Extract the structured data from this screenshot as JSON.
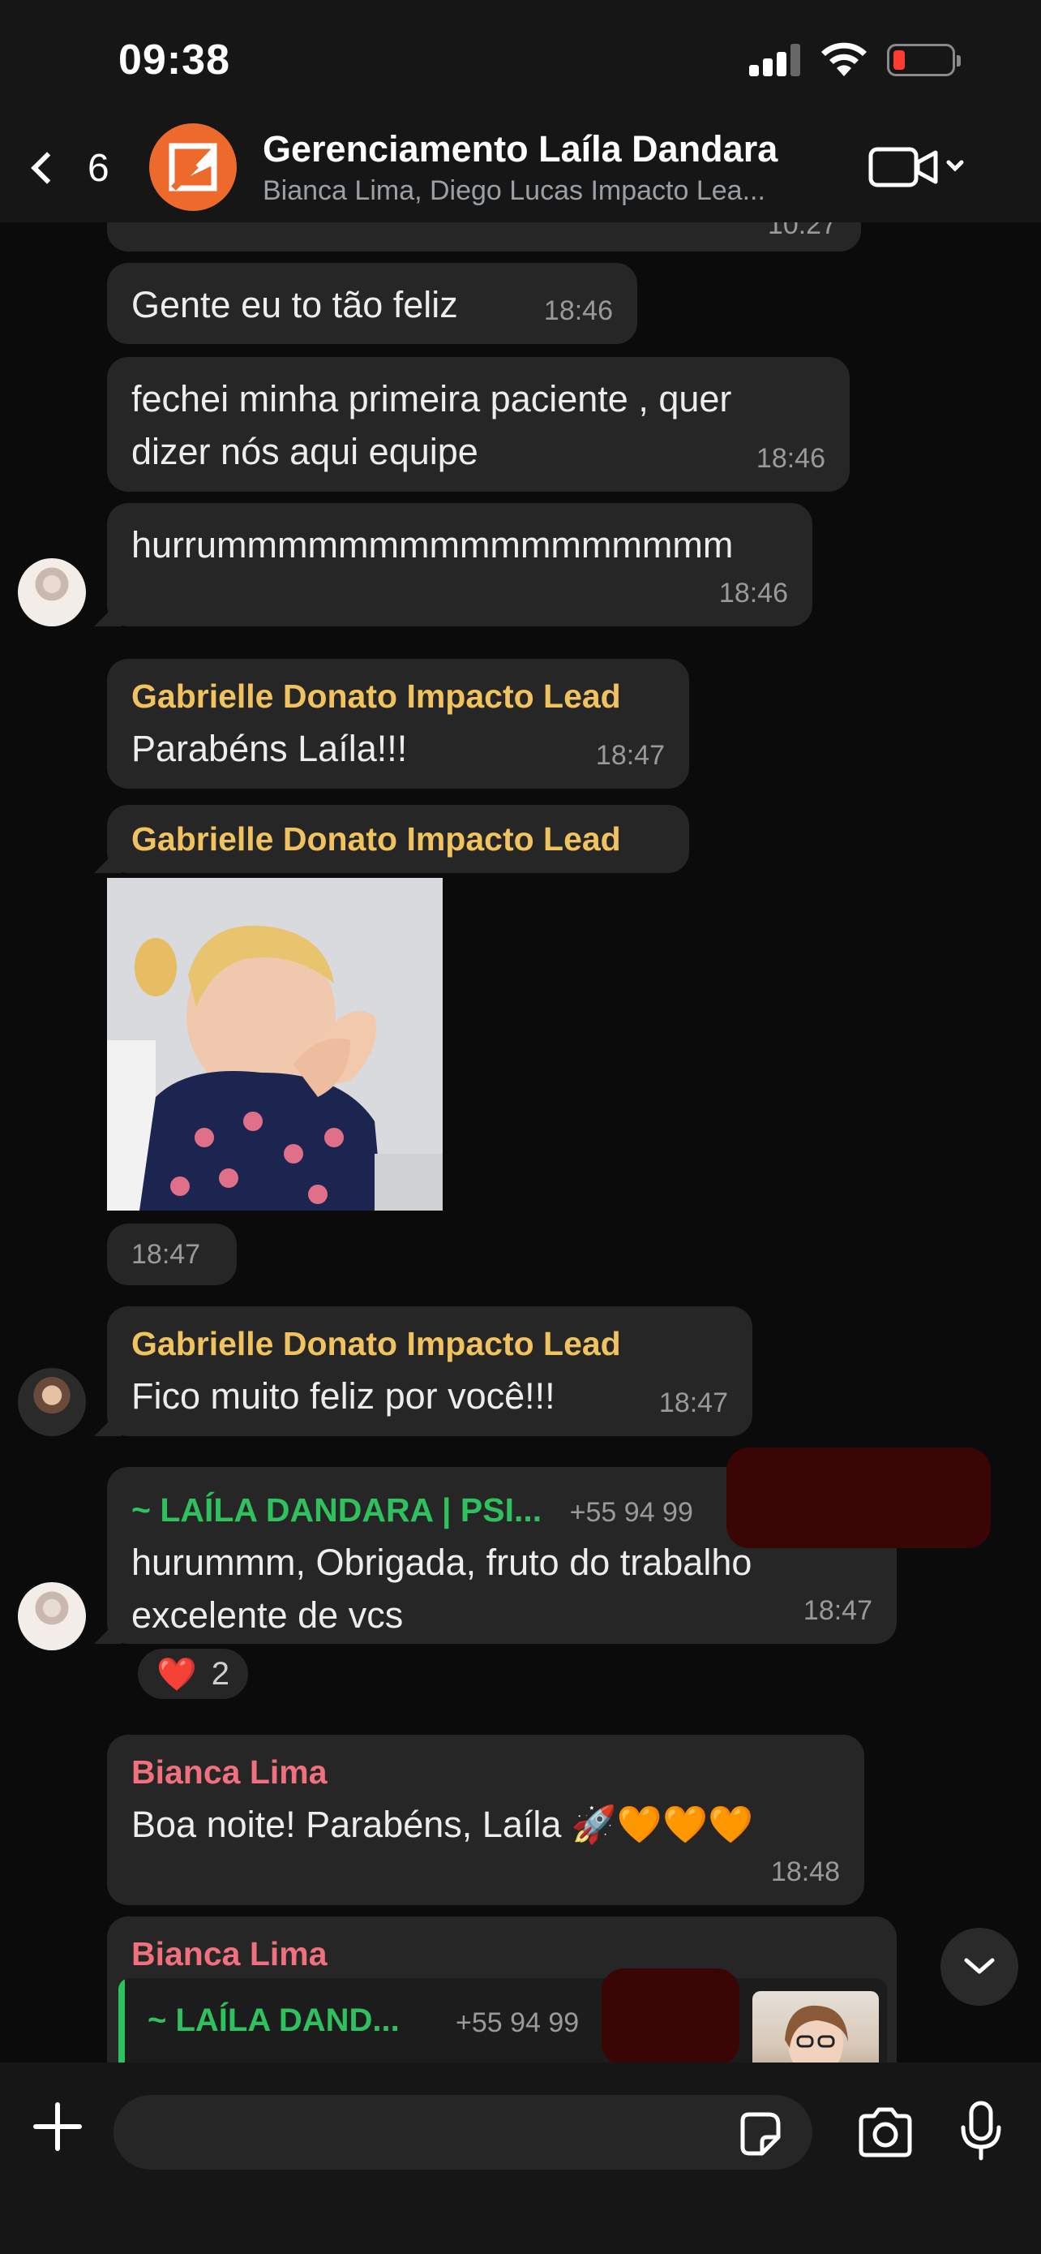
{
  "status_bar": {
    "time": "09:38",
    "battery_level": 0.15,
    "battery_color": "#ff3b30"
  },
  "header": {
    "back_count": "6",
    "title": "Gerenciamento Laíla Dandara",
    "subtitle": "Bianca Lima, Diego Lucas Impacto Lea...",
    "avatar_color": "#ee6a2c",
    "icons": [
      "chevron-left-icon",
      "video-camera-icon",
      "chevron-down-icon"
    ]
  },
  "messages": {
    "prev_time": "10:27",
    "m1": {
      "text": "Gente eu to tão feliz",
      "time": "18:46"
    },
    "m2": {
      "text": "fechei minha primeira paciente , quer dizer nós aqui equipe",
      "time": "18:46"
    },
    "m3": {
      "text": "hurrummmmmmmmmmmmmmmmm",
      "time": "18:46"
    },
    "m4": {
      "sender": "Gabrielle Donato Impacto Lead",
      "text": "Parabéns Laíla!!!",
      "time": "18:47"
    },
    "m5": {
      "sender": "Gabrielle Donato Impacto Lead",
      "time": "18:47"
    },
    "m6": {
      "sender": "Gabrielle Donato Impacto Lead",
      "text": "Fico muito feliz por você!!!",
      "time": "18:47"
    },
    "m7": {
      "sender": "~ LAÍLA DANDARA | PSI...",
      "phone": "+55 94 99",
      "text": "hurummm, Obrigada, fruto do trabalho excelente de vcs",
      "time": "18:47",
      "reaction_emoji": "❤️",
      "reaction_count": "2"
    },
    "m8": {
      "sender": "Bianca Lima",
      "text": "Boa noite! Parabéns, Laíla 🚀🧡🧡🧡",
      "time": "18:48"
    },
    "m9": {
      "sender": "Bianca Lima",
      "quote_name": "~ LAÍLA DAND...",
      "quote_phone": "+55 94 99"
    }
  },
  "colors": {
    "gold": "#f0c35f",
    "green": "#2fc15e",
    "pink": "#f0707d",
    "bubble": "#262626"
  },
  "input": {
    "placeholder": ""
  }
}
